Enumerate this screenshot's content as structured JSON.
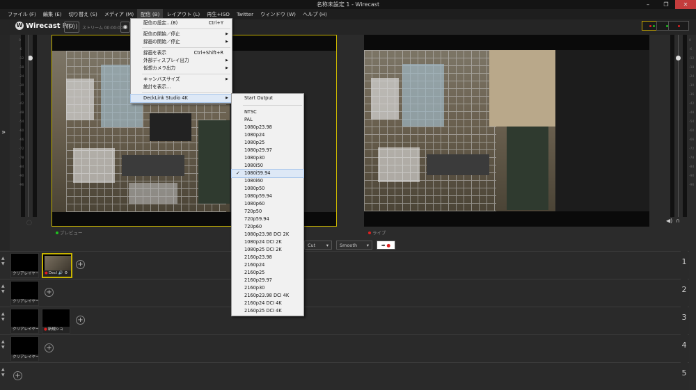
{
  "window": {
    "title": "名称未設定 1 - Wirecast",
    "controls": [
      "–",
      "❐",
      "✕"
    ]
  },
  "menubar": [
    "ファイル (F)",
    "編集 (E)",
    "切り替え (S)",
    "メディア (M)",
    "配信 (B)",
    "レイアウト (L)",
    "再生+ISO",
    "Twitter",
    "ウィンドウ (W)",
    "ヘルプ (H)"
  ],
  "app": {
    "logo_letter": "W",
    "name_bold": "Wirecast",
    "name_suffix": "Pro",
    "stream_label": "ストリーム 00:00:00"
  },
  "colors": {
    "accent_yellow": "#c8b400",
    "tally_red": "#e02020",
    "tally_green": "#20c020",
    "live_red": "#e02020"
  },
  "meter_scale": [
    "0",
    "-6",
    "-12",
    "-18",
    "-24",
    "-30",
    "-36",
    "-42",
    "-48",
    "-54",
    "-60",
    "-66",
    "-72",
    "-78",
    "-84",
    "-90",
    "-96"
  ],
  "preview": {
    "label": "プレビュー"
  },
  "live": {
    "label": "ライブ"
  },
  "transition": {
    "cut_label": "Cut",
    "smooth_label": "Smooth",
    "go_label": "➡"
  },
  "broadcast_menu": {
    "items": [
      {
        "label": "配信の設定…(B)",
        "shortcut": "Ctrl+Y",
        "submenu": false
      },
      {
        "sep": true
      },
      {
        "label": "配信の開始／停止",
        "shortcut": "",
        "submenu": true
      },
      {
        "label": "録画の開始／停止",
        "shortcut": "",
        "submenu": true
      },
      {
        "sep": true
      },
      {
        "label": "録画を表示",
        "shortcut": "Ctrl+Shift+R",
        "submenu": false
      },
      {
        "label": "外部ディスプレイ出力",
        "shortcut": "",
        "submenu": true
      },
      {
        "label": "仮想カメラ出力",
        "shortcut": "",
        "submenu": true
      },
      {
        "sep": true
      },
      {
        "label": "キャンバスサイズ",
        "shortcut": "",
        "submenu": true
      },
      {
        "label": "統計を表示…",
        "shortcut": "",
        "submenu": false
      },
      {
        "sep": true
      },
      {
        "label": "DeckLink Studio 4K",
        "shortcut": "",
        "submenu": true,
        "highlighted": true
      }
    ]
  },
  "decklink_menu": {
    "start": "Start Output",
    "formats": [
      "NTSC",
      "PAL",
      "1080p23.98",
      "1080p24",
      "1080p25",
      "1080p29.97",
      "1080p30",
      "1080i50",
      "1080i59.94",
      "1080i60",
      "1080p50",
      "1080p59.94",
      "1080p60",
      "720p50",
      "720p59.94",
      "720p60",
      "1080p23.98 DCI 2K",
      "1080p24 DCI 2K",
      "1080p25 DCI 2K",
      "2160p23.98",
      "2160p24",
      "2160p25",
      "2160p29.97",
      "2160p30",
      "2160p23.98 DCI 4K",
      "2160p24 DCI 4K",
      "2160p25 DCI 4K"
    ],
    "selected": "1080i59.94"
  },
  "layers": [
    {
      "number": "1",
      "shots": [
        {
          "label": "クリアレイヤー",
          "type": "clear"
        },
        {
          "label": "Decl 🔊 ⚙",
          "type": "camera",
          "selected": true
        }
      ]
    },
    {
      "number": "2",
      "shots": [
        {
          "label": "クリアレイヤー",
          "type": "clear"
        }
      ]
    },
    {
      "number": "3",
      "shots": [
        {
          "label": "クリアレイヤー",
          "type": "clear"
        },
        {
          "label": "新規ショ",
          "type": "new"
        }
      ]
    },
    {
      "number": "4",
      "shots": [
        {
          "label": "クリアレイヤー",
          "type": "clear"
        }
      ]
    },
    {
      "number": "5",
      "shots": []
    }
  ],
  "add_symbol": "+"
}
